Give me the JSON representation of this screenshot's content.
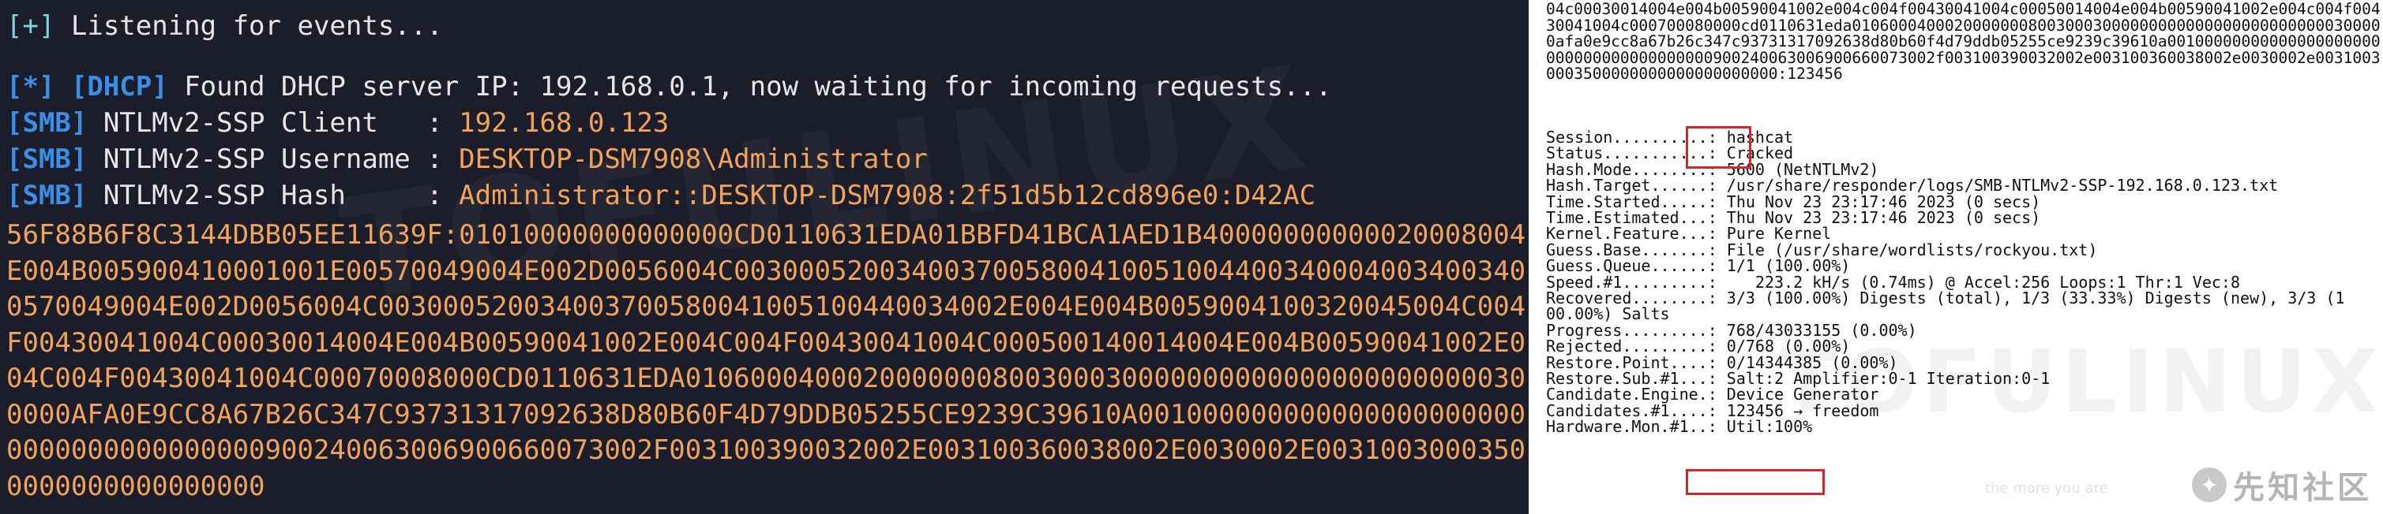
{
  "left_terminal": {
    "listening": {
      "prefix": "[+]",
      "text": " Listening for events..."
    },
    "dhcp": {
      "prefix": "[*]",
      "tag": " [DHCP]",
      "text": " Found DHCP server IP: 192.168.0.1, now waiting for incoming requests..."
    },
    "smb_client": {
      "tag": "[SMB]",
      "label": " NTLMv2-SSP Client   : ",
      "value": "192.168.0.123"
    },
    "smb_username": {
      "tag": "[SMB]",
      "label": " NTLMv2-SSP Username : ",
      "value": "DESKTOP-DSM7908\\Administrator"
    },
    "smb_hash": {
      "tag": "[SMB]",
      "label": " NTLMv2-SSP Hash     : ",
      "value": "Administrator::DESKTOP-DSM7908:2f51d5b12cd896e0:D42AC56F88B6F8C3144DBB05EE11639F:01010000000000000CD0110631EDA01BBFD41BCA1AED1B40000000000020008004E004B005900410001001E00570049004E002D0056004C00300052003400370058004100510044003400040034003400570049004E002D0056004C003000520034003700580041005100440034002E004E004B0059004100320045004C004F00430041004C00030014004E004B00590041002E004C004F00430041004C000500140014004E004B00590041002E004C004F00430041004C00070008000CD0110631EDA01060004000200000008003000300000000000000000000000300000AFA0E9CC8A67B26C347C93731317092638D80B60F4D79DDB05255CE9239C39610A0010000000000000000000000000000000000000900240063006900660073002F003100390032002E003100360038002E0030002E00310030003500000000000000000"
    },
    "watermark": "TOFULINUX"
  },
  "right_terminal": {
    "hash_tail": "04c00030014004e004b00590041002e004c004f00430041004c00050014004e004b00590041002e004c004f00430041004c000700080000cd0110631eda0106000400020000000800300030000000000000000000000000300000afa0e9cc8a67b26c347c93731317092638d80b60f4d79ddb05255ce9239c39610a00100000000000000000000000000000000000000900240063006900660073002f003100390032002e003100360038002e0030002e00310030003500000000000000000000:123456",
    "rows": [
      {
        "key": "Session..........:",
        "value": "hashcat"
      },
      {
        "key": "Status...........:",
        "value": "Cracked"
      },
      {
        "key": "Hash.Mode........:",
        "value": "5600 (NetNTLMv2)"
      },
      {
        "key": "Hash.Target......:",
        "value": "/usr/share/responder/logs/SMB-NTLMv2-SSP-192.168.0.123.txt"
      },
      {
        "key": "Time.Started.....:",
        "value": "Thu Nov 23 23:17:46 2023 (0 secs)"
      },
      {
        "key": "Time.Estimated...:",
        "value": "Thu Nov 23 23:17:46 2023 (0 secs)"
      },
      {
        "key": "Kernel.Feature...:",
        "value": "Pure Kernel"
      },
      {
        "key": "Guess.Base.......:",
        "value": "File (/usr/share/wordlists/rockyou.txt)"
      },
      {
        "key": "Guess.Queue......:",
        "value": "1/1 (100.00%)"
      },
      {
        "key": "Speed.#1.........:",
        "value": "   223.2 kH/s (0.74ms) @ Accel:256 Loops:1 Thr:1 Vec:8"
      },
      {
        "key": "Recovered........:",
        "value": "3/3 (100.00%) Digests (total), 1/3 (33.33%) Digests (new), 3/3 (1"
      },
      {
        "key": "",
        "value": "00.00%) Salts"
      },
      {
        "key": "Progress.........:",
        "value": "768/43033155 (0.00%)"
      },
      {
        "key": "Rejected.........:",
        "value": "0/768 (0.00%)"
      },
      {
        "key": "Restore.Point....:",
        "value": "0/14344385 (0.00%)"
      },
      {
        "key": "Restore.Sub.#1...:",
        "value": "Salt:2 Amplifier:0-1 Iteration:0-1"
      },
      {
        "key": "Candidate.Engine.:",
        "value": "Device Generator"
      },
      {
        "key": "Candidates.#1....:",
        "value": "123456 → freedom"
      },
      {
        "key": "Hardware.Mon.#1..:",
        "value": "Util:100%"
      }
    ],
    "watermark": "TOFULINUX",
    "faint_caption": "the more you are",
    "logo_text": "先知社区"
  }
}
